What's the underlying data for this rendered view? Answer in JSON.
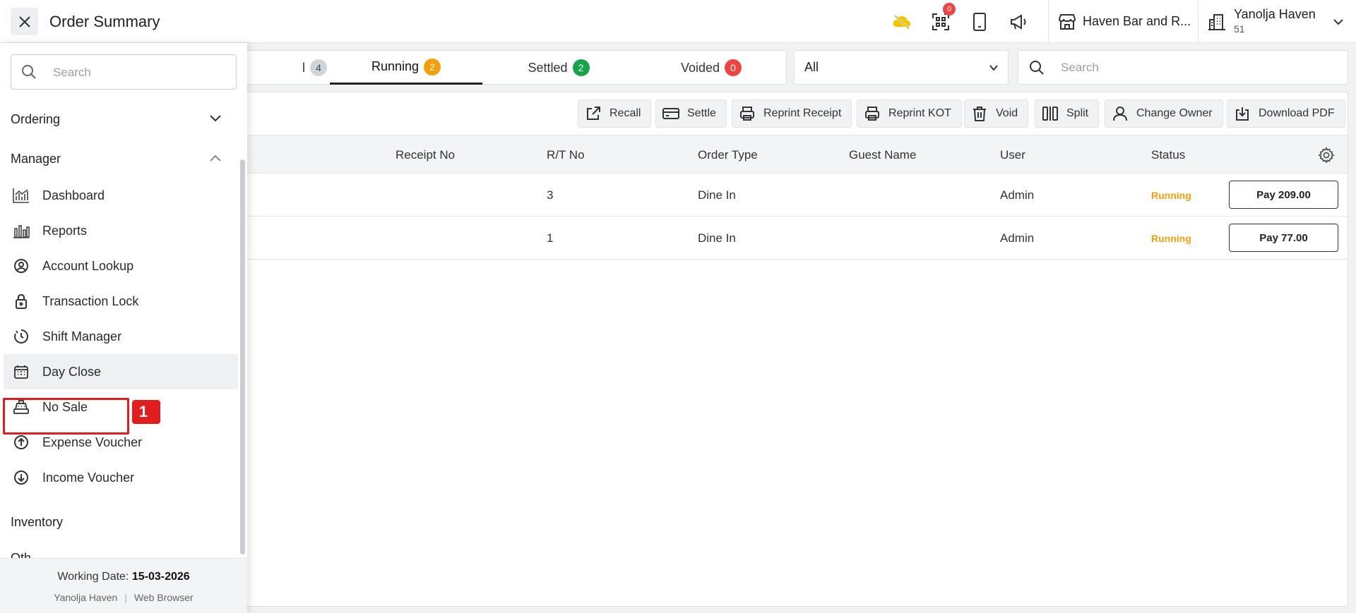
{
  "header": {
    "title": "Order Summary",
    "notification_count": "0",
    "store_name": "Haven Bar and R...",
    "user_name": "Yanolja Haven",
    "user_id": "51"
  },
  "tabs": [
    {
      "label": "l",
      "count": "4",
      "color": "#d1d5db"
    },
    {
      "label": "Running",
      "count": "2",
      "color": "#f59e0b"
    },
    {
      "label": "Settled",
      "count": "2",
      "color": "#16a34a"
    },
    {
      "label": "Voided",
      "count": "0",
      "color": "#ef4444"
    }
  ],
  "filter": {
    "selected": "All"
  },
  "search": {
    "placeholder": "Search"
  },
  "toolbar": {
    "recall": "Recall",
    "settle": "Settle",
    "reprint_receipt": "Reprint Receipt",
    "reprint_kot": "Reprint KOT",
    "void": "Void",
    "split": "Split",
    "change_owner": "Change Owner",
    "download_pdf": "Download PDF"
  },
  "table": {
    "columns": {
      "receipt_no": "Receipt No",
      "rt_no": "R/T No",
      "order_type": "Order Type",
      "guest_name": "Guest Name",
      "user": "User",
      "status": "Status"
    },
    "rows": [
      {
        "rt_no": "3",
        "order_type": "Dine In",
        "user": "Admin",
        "status": "Running",
        "pay": "Pay 209.00"
      },
      {
        "rt_no": "1",
        "order_type": "Dine In",
        "user": "Admin",
        "status": "Running",
        "pay": "Pay 77.00"
      }
    ]
  },
  "sidebar": {
    "search_placeholder": "Search",
    "sections": {
      "ordering": "Ordering",
      "manager": "Manager",
      "inventory": "Inventory",
      "other": "Oth"
    },
    "items": [
      {
        "label": "Dashboard",
        "icon": "dashboard-chart-icon"
      },
      {
        "label": "Reports",
        "icon": "bar-chart-icon"
      },
      {
        "label": "Account Lookup",
        "icon": "user-circle-icon"
      },
      {
        "label": "Transaction Lock",
        "icon": "lock-icon"
      },
      {
        "label": "Shift Manager",
        "icon": "timer-icon"
      },
      {
        "label": "Day Close",
        "icon": "calendar-icon"
      },
      {
        "label": "No Sale",
        "icon": "cash-register-icon"
      },
      {
        "label": "Expense Voucher",
        "icon": "arrow-up-circle-icon"
      },
      {
        "label": "Income Voucher",
        "icon": "arrow-down-circle-icon"
      }
    ],
    "annotation": "1",
    "footer": {
      "working_date_label": "Working Date:",
      "working_date": "15-03-2026",
      "venue": "Yanolja Haven",
      "client": "Web Browser"
    }
  }
}
